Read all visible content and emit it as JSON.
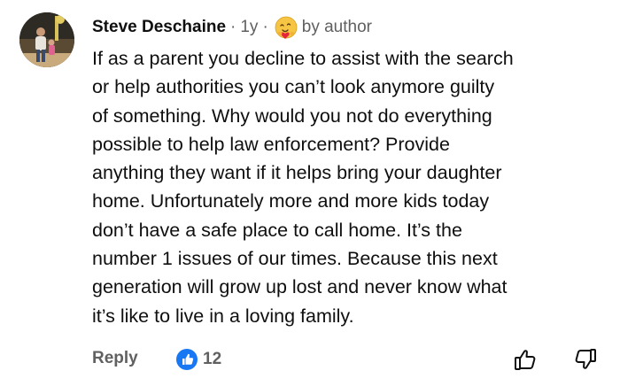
{
  "comment": {
    "author": "Steve Deschaine",
    "separator": "·",
    "time": "1y",
    "separator2": "·",
    "author_badge_icon": "heart-emoji-icon",
    "author_badge_label": "by author",
    "text": "If as a parent you decline to assist with the search\nor help authorities you can’t look anymore guilty\nof something. Why would you not do everything\npossible to help law enforcement? Provide\nanything they want if it helps bring your daughter\nhome. Unfortunately more and more kids today\ndon’t have a safe place to call home. It’s the\nnumber 1 issues of our times. Because this next\ngeneration will grow up lost and never know what\nit’s like to live in a loving family."
  },
  "actions": {
    "reply_label": "Reply",
    "like_icon": "like-reaction-icon",
    "like_count": "12",
    "thumb_up_icon": "thumbs-up-icon",
    "thumb_down_icon": "thumbs-down-icon"
  },
  "colors": {
    "text_primary": "#0f0f0f",
    "text_secondary": "#606060",
    "like_blue": "#1877f2"
  }
}
